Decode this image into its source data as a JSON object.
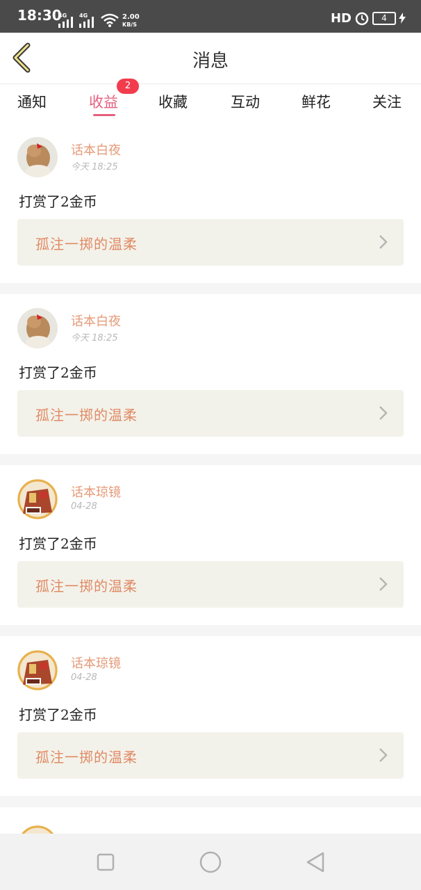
{
  "status": {
    "time": "18:30",
    "sig1": "4G",
    "sig2": "4G",
    "speed_top": "2.00",
    "speed_bottom": "KB/S",
    "hd": "HD",
    "battery": "4"
  },
  "header": {
    "title": "消息"
  },
  "tabs": [
    {
      "label": "通知"
    },
    {
      "label": "收益"
    },
    {
      "label": "收藏"
    },
    {
      "label": "互动"
    },
    {
      "label": "鲜花"
    },
    {
      "label": "关注"
    }
  ],
  "badge": "2",
  "cards": [
    {
      "name": "话本白夜",
      "time": "今天 18:25",
      "text": "打赏了2金币",
      "link": "孤注一掷的温柔"
    },
    {
      "name": "话本白夜",
      "time": "今天 18:25",
      "text": "打赏了2金币",
      "link": "孤注一掷的温柔"
    },
    {
      "name": "话本琼镜",
      "time": "04-28",
      "text": "打赏了2金币",
      "link": "孤注一掷的温柔"
    },
    {
      "name": "话本琼镜",
      "time": "04-28",
      "text": "打赏了2金币",
      "link": "孤注一掷的温柔"
    }
  ]
}
